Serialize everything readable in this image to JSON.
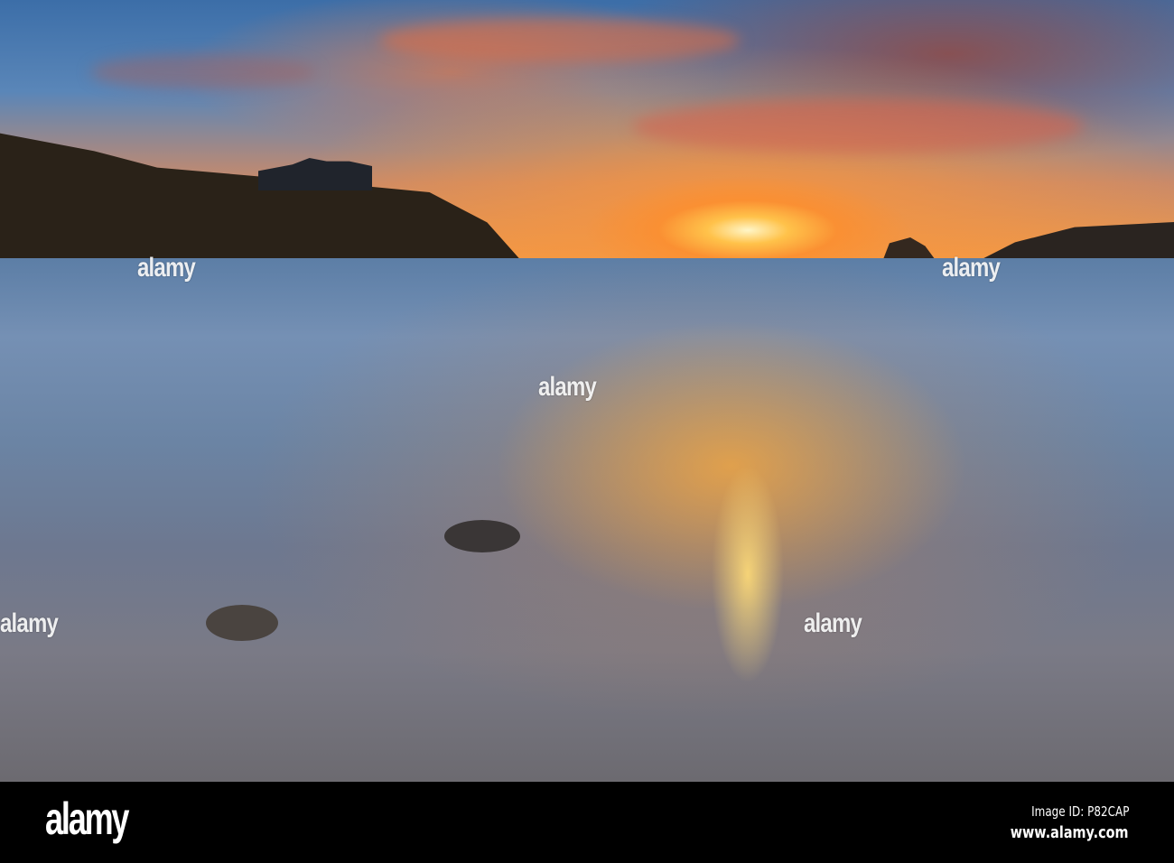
{
  "watermark": {
    "text": "alamy"
  },
  "footer": {
    "logo": "alamy",
    "image_id": "Image ID: P82CAP",
    "url": "www.alamy.com"
  }
}
